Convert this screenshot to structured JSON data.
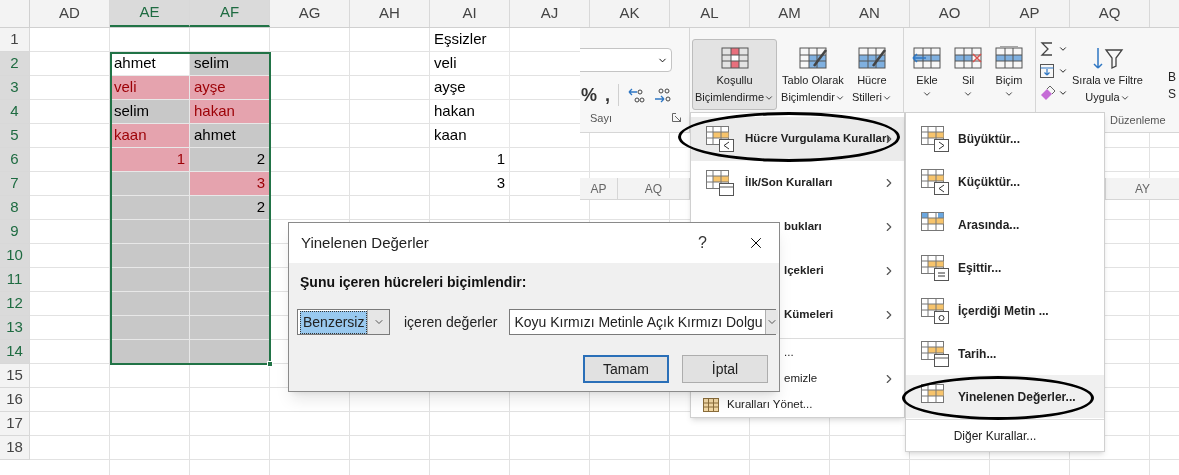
{
  "sheet": {
    "columns": [
      {
        "label": "AD",
        "selected": false
      },
      {
        "label": "AE",
        "selected": true
      },
      {
        "label": "AF",
        "selected": true
      },
      {
        "label": "AG",
        "selected": false
      },
      {
        "label": "AH",
        "selected": false
      },
      {
        "label": "AI",
        "selected": false
      },
      {
        "label": "AJ",
        "selected": false
      },
      {
        "label": "AK",
        "selected": false
      },
      {
        "label": "AL",
        "selected": false
      },
      {
        "label": "AM",
        "selected": false
      },
      {
        "label": "AN",
        "selected": false
      },
      {
        "label": "AO",
        "selected": false
      },
      {
        "label": "AP",
        "selected": false
      },
      {
        "label": "AQ",
        "selected": false
      }
    ],
    "rows": [
      {
        "label": "1",
        "selected": false,
        "cells": [
          {
            "kind": "normal"
          },
          {
            "kind": "normal"
          },
          {
            "kind": "normal"
          },
          {
            "kind": "normal"
          },
          {
            "kind": "normal"
          },
          {
            "kind": "normal",
            "text": "Eşsizler"
          }
        ]
      },
      {
        "label": "2",
        "selected": true,
        "cells": [
          {
            "kind": "normal"
          },
          {
            "kind": "active",
            "text": "ahmet"
          },
          {
            "kind": "selected",
            "text": "selim"
          },
          {
            "kind": "normal"
          },
          {
            "kind": "normal"
          },
          {
            "kind": "normal",
            "text": "veli"
          }
        ]
      },
      {
        "label": "3",
        "selected": true,
        "cells": [
          {
            "kind": "normal"
          },
          {
            "kind": "duplicate",
            "text": "veli"
          },
          {
            "kind": "duplicate",
            "text": "ayşe"
          },
          {
            "kind": "normal"
          },
          {
            "kind": "normal"
          },
          {
            "kind": "normal",
            "text": "ayşe"
          }
        ]
      },
      {
        "label": "4",
        "selected": true,
        "cells": [
          {
            "kind": "normal"
          },
          {
            "kind": "selected",
            "text": "selim"
          },
          {
            "kind": "duplicate",
            "text": "hakan"
          },
          {
            "kind": "normal"
          },
          {
            "kind": "normal"
          },
          {
            "kind": "normal",
            "text": "hakan"
          }
        ]
      },
      {
        "label": "5",
        "selected": true,
        "cells": [
          {
            "kind": "normal"
          },
          {
            "kind": "duplicate",
            "text": "kaan"
          },
          {
            "kind": "selected",
            "text": "ahmet"
          },
          {
            "kind": "normal"
          },
          {
            "kind": "normal"
          },
          {
            "kind": "normal",
            "text": "kaan"
          }
        ]
      },
      {
        "label": "6",
        "selected": true,
        "cells": [
          {
            "kind": "normal"
          },
          {
            "kind": "duplicate",
            "text": "1",
            "numeric": true
          },
          {
            "kind": "selected",
            "text": "2",
            "numeric": true
          },
          {
            "kind": "normal"
          },
          {
            "kind": "normal"
          },
          {
            "kind": "normal",
            "text": "1",
            "numeric": true
          }
        ]
      },
      {
        "label": "7",
        "selected": true,
        "cells": [
          {
            "kind": "normal"
          },
          {
            "kind": "selected"
          },
          {
            "kind": "duplicate",
            "text": "3",
            "numeric": true
          },
          {
            "kind": "normal"
          },
          {
            "kind": "normal"
          },
          {
            "kind": "normal",
            "text": "3",
            "numeric": true
          }
        ]
      },
      {
        "label": "8",
        "selected": true,
        "cells": [
          {
            "kind": "normal"
          },
          {
            "kind": "selected"
          },
          {
            "kind": "selected",
            "text": "2",
            "numeric": true
          }
        ]
      },
      {
        "label": "9",
        "selected": true,
        "cells": [
          {
            "kind": "normal"
          },
          {
            "kind": "selected"
          },
          {
            "kind": "selected"
          }
        ]
      },
      {
        "label": "10",
        "selected": true,
        "cells": [
          {
            "kind": "normal"
          },
          {
            "kind": "selected"
          },
          {
            "kind": "selected"
          }
        ]
      },
      {
        "label": "11",
        "selected": true,
        "cells": [
          {
            "kind": "normal"
          },
          {
            "kind": "selected"
          },
          {
            "kind": "selected"
          }
        ]
      },
      {
        "label": "12",
        "selected": true,
        "cells": [
          {
            "kind": "normal"
          },
          {
            "kind": "selected"
          },
          {
            "kind": "selected"
          }
        ]
      },
      {
        "label": "13",
        "selected": true,
        "cells": [
          {
            "kind": "normal"
          },
          {
            "kind": "selected"
          },
          {
            "kind": "selected"
          }
        ]
      },
      {
        "label": "14",
        "selected": true,
        "cells": [
          {
            "kind": "normal"
          },
          {
            "kind": "selected"
          },
          {
            "kind": "selected"
          }
        ]
      },
      {
        "label": "15",
        "selected": false
      },
      {
        "label": "16",
        "selected": false
      },
      {
        "label": "17",
        "selected": false
      },
      {
        "label": "18",
        "selected": false
      }
    ]
  },
  "ribbon": {
    "groups": [
      {
        "kind": "number",
        "label": "Sayı",
        "symbols": [
          "%",
          ","
        ]
      },
      {
        "kind": "styles",
        "buttons": [
          {
            "lines": [
              "Koşullu",
              "Biçimlendirme"
            ],
            "pressed": true
          },
          {
            "lines": [
              "Tablo Olarak",
              "Biçimlendir"
            ],
            "pressed": false
          },
          {
            "lines": [
              "Hücre",
              "Stilleri"
            ],
            "pressed": false
          }
        ]
      },
      {
        "kind": "cells",
        "buttons": [
          {
            "lines": [
              "Ekle"
            ],
            "pressed": false
          },
          {
            "lines": [
              "Sil"
            ],
            "pressed": false
          },
          {
            "lines": [
              "Biçim"
            ],
            "pressed": false
          }
        ]
      },
      {
        "kind": "editing",
        "label": "Düzenleme",
        "buttons": [
          {
            "lines": [
              "Sırala ve Filtre",
              "Uygula"
            ],
            "pressed": false
          }
        ],
        "cut_text": [
          "B",
          "S"
        ]
      }
    ]
  },
  "second_sheet": {
    "left_columns": [
      "AP",
      "AQ"
    ],
    "right_columns": [
      "AY"
    ]
  },
  "menu": {
    "items": [
      {
        "label": "Hücre Vurgulama Kuralları",
        "kind": "rule",
        "covered": false,
        "has_submenu": true,
        "highlighted": true
      },
      {
        "label": "İlk/Son Kuralları",
        "kind": "rule",
        "covered": false,
        "has_submenu": true,
        "highlighted": false
      },
      {
        "label": "bukları",
        "kind": "rule",
        "covered": true,
        "has_submenu": true,
        "highlighted": false
      },
      {
        "label": "lçekleri",
        "kind": "rule",
        "covered": true,
        "has_submenu": true,
        "highlighted": false
      },
      {
        "label": "Kümeleri",
        "kind": "rule",
        "covered": true,
        "has_submenu": true,
        "highlighted": false
      },
      {
        "label": "...",
        "kind": "command",
        "covered": true,
        "has_submenu": false,
        "highlighted": false
      },
      {
        "label": "emizle",
        "kind": "command",
        "covered": true,
        "has_submenu": true,
        "highlighted": false
      },
      {
        "label": "Kuralları Yönet...",
        "kind": "command",
        "covered": false,
        "has_submenu": false,
        "highlighted": false
      }
    ]
  },
  "submenu": {
    "items": [
      {
        "label": "Büyüktür...",
        "kind": "rule",
        "highlighted": false
      },
      {
        "label": "Küçüktür...",
        "kind": "rule",
        "highlighted": false
      },
      {
        "label": "Arasında...",
        "kind": "rule",
        "highlighted": false
      },
      {
        "label": "Eşittir...",
        "kind": "rule",
        "highlighted": false
      },
      {
        "label": "İçerdiği Metin ...",
        "kind": "rule",
        "highlighted": false
      },
      {
        "label": "Tarih...",
        "kind": "rule",
        "highlighted": false
      },
      {
        "label": "Yinelenen Değerler...",
        "kind": "rule",
        "highlighted": true
      },
      {
        "label": "Diğer Kurallar...",
        "kind": "command",
        "highlighted": false
      }
    ]
  },
  "dialog": {
    "title": "Yinelenen Değerler",
    "help_button": "?",
    "prompt": "Şunu içeren hücreleri biçimlendir:",
    "type_select": {
      "value": "Benzersiz",
      "focused": true
    },
    "middle_text": "içeren değerler",
    "format_select": {
      "value": "Koyu Kırmızı Metinle Açık Kırmızı Dolgu",
      "focused": false
    },
    "buttons": [
      {
        "label": "Tamam",
        "default": true
      },
      {
        "label": "İptal",
        "default": false
      }
    ]
  }
}
